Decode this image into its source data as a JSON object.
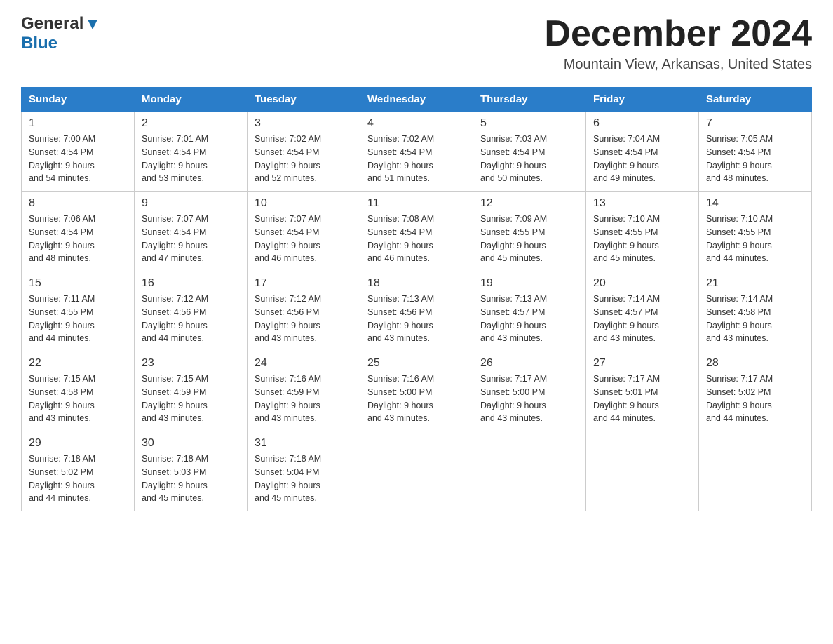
{
  "header": {
    "logo_general": "General",
    "logo_blue": "Blue",
    "month_title": "December 2024",
    "location": "Mountain View, Arkansas, United States"
  },
  "days_of_week": [
    "Sunday",
    "Monday",
    "Tuesday",
    "Wednesday",
    "Thursday",
    "Friday",
    "Saturday"
  ],
  "weeks": [
    [
      {
        "day": "1",
        "sunrise": "7:00 AM",
        "sunset": "4:54 PM",
        "daylight": "9 hours and 54 minutes."
      },
      {
        "day": "2",
        "sunrise": "7:01 AM",
        "sunset": "4:54 PM",
        "daylight": "9 hours and 53 minutes."
      },
      {
        "day": "3",
        "sunrise": "7:02 AM",
        "sunset": "4:54 PM",
        "daylight": "9 hours and 52 minutes."
      },
      {
        "day": "4",
        "sunrise": "7:02 AM",
        "sunset": "4:54 PM",
        "daylight": "9 hours and 51 minutes."
      },
      {
        "day": "5",
        "sunrise": "7:03 AM",
        "sunset": "4:54 PM",
        "daylight": "9 hours and 50 minutes."
      },
      {
        "day": "6",
        "sunrise": "7:04 AM",
        "sunset": "4:54 PM",
        "daylight": "9 hours and 49 minutes."
      },
      {
        "day": "7",
        "sunrise": "7:05 AM",
        "sunset": "4:54 PM",
        "daylight": "9 hours and 48 minutes."
      }
    ],
    [
      {
        "day": "8",
        "sunrise": "7:06 AM",
        "sunset": "4:54 PM",
        "daylight": "9 hours and 48 minutes."
      },
      {
        "day": "9",
        "sunrise": "7:07 AM",
        "sunset": "4:54 PM",
        "daylight": "9 hours and 47 minutes."
      },
      {
        "day": "10",
        "sunrise": "7:07 AM",
        "sunset": "4:54 PM",
        "daylight": "9 hours and 46 minutes."
      },
      {
        "day": "11",
        "sunrise": "7:08 AM",
        "sunset": "4:54 PM",
        "daylight": "9 hours and 46 minutes."
      },
      {
        "day": "12",
        "sunrise": "7:09 AM",
        "sunset": "4:55 PM",
        "daylight": "9 hours and 45 minutes."
      },
      {
        "day": "13",
        "sunrise": "7:10 AM",
        "sunset": "4:55 PM",
        "daylight": "9 hours and 45 minutes."
      },
      {
        "day": "14",
        "sunrise": "7:10 AM",
        "sunset": "4:55 PM",
        "daylight": "9 hours and 44 minutes."
      }
    ],
    [
      {
        "day": "15",
        "sunrise": "7:11 AM",
        "sunset": "4:55 PM",
        "daylight": "9 hours and 44 minutes."
      },
      {
        "day": "16",
        "sunrise": "7:12 AM",
        "sunset": "4:56 PM",
        "daylight": "9 hours and 44 minutes."
      },
      {
        "day": "17",
        "sunrise": "7:12 AM",
        "sunset": "4:56 PM",
        "daylight": "9 hours and 43 minutes."
      },
      {
        "day": "18",
        "sunrise": "7:13 AM",
        "sunset": "4:56 PM",
        "daylight": "9 hours and 43 minutes."
      },
      {
        "day": "19",
        "sunrise": "7:13 AM",
        "sunset": "4:57 PM",
        "daylight": "9 hours and 43 minutes."
      },
      {
        "day": "20",
        "sunrise": "7:14 AM",
        "sunset": "4:57 PM",
        "daylight": "9 hours and 43 minutes."
      },
      {
        "day": "21",
        "sunrise": "7:14 AM",
        "sunset": "4:58 PM",
        "daylight": "9 hours and 43 minutes."
      }
    ],
    [
      {
        "day": "22",
        "sunrise": "7:15 AM",
        "sunset": "4:58 PM",
        "daylight": "9 hours and 43 minutes."
      },
      {
        "day": "23",
        "sunrise": "7:15 AM",
        "sunset": "4:59 PM",
        "daylight": "9 hours and 43 minutes."
      },
      {
        "day": "24",
        "sunrise": "7:16 AM",
        "sunset": "4:59 PM",
        "daylight": "9 hours and 43 minutes."
      },
      {
        "day": "25",
        "sunrise": "7:16 AM",
        "sunset": "5:00 PM",
        "daylight": "9 hours and 43 minutes."
      },
      {
        "day": "26",
        "sunrise": "7:17 AM",
        "sunset": "5:00 PM",
        "daylight": "9 hours and 43 minutes."
      },
      {
        "day": "27",
        "sunrise": "7:17 AM",
        "sunset": "5:01 PM",
        "daylight": "9 hours and 44 minutes."
      },
      {
        "day": "28",
        "sunrise": "7:17 AM",
        "sunset": "5:02 PM",
        "daylight": "9 hours and 44 minutes."
      }
    ],
    [
      {
        "day": "29",
        "sunrise": "7:18 AM",
        "sunset": "5:02 PM",
        "daylight": "9 hours and 44 minutes."
      },
      {
        "day": "30",
        "sunrise": "7:18 AM",
        "sunset": "5:03 PM",
        "daylight": "9 hours and 45 minutes."
      },
      {
        "day": "31",
        "sunrise": "7:18 AM",
        "sunset": "5:04 PM",
        "daylight": "9 hours and 45 minutes."
      },
      null,
      null,
      null,
      null
    ]
  ]
}
